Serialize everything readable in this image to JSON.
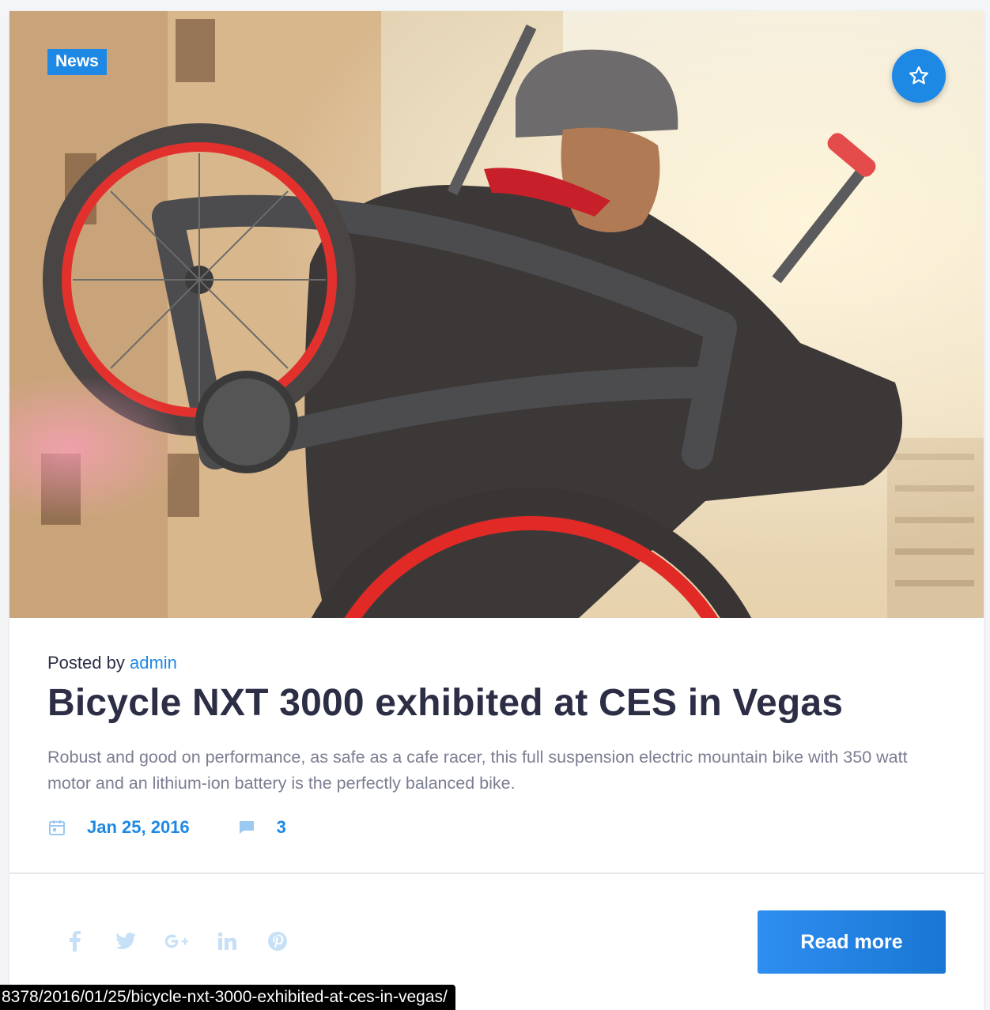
{
  "post": {
    "category_badge": "News",
    "favorite_icon": "star-outline-icon",
    "hero_image_alt": "",
    "posted_by_prefix": "Posted by",
    "author": "admin",
    "title": "Bicycle NXT 3000 exhibited at CES in Vegas",
    "excerpt": "Robust and good on performance, as safe as a cafe racer, this full suspension electric mountain bike with 350 watt motor and an lithium-ion battery is the perfectly balanced bike.",
    "date": "Jan 25, 2016",
    "comments_count": "3",
    "read_more_label": "Read more"
  },
  "social": [
    {
      "name": "facebook-icon"
    },
    {
      "name": "twitter-icon"
    },
    {
      "name": "google-plus-icon"
    },
    {
      "name": "linkedin-icon"
    },
    {
      "name": "pinterest-icon"
    }
  ],
  "statusbar": {
    "url": "8378/2016/01/25/bicycle-nxt-3000-exhibited-at-ces-in-vegas/"
  },
  "colors": {
    "accent": "#1e88e5",
    "title": "#2b2e45",
    "muted_text": "#7b7e92",
    "social_icon": "#bfdcf7"
  }
}
